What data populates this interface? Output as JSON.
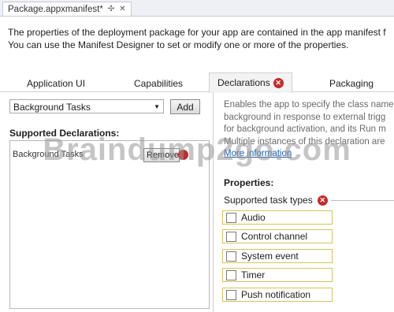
{
  "document_tab": {
    "title": "Package.appxmanifest*",
    "pin_icon": "pin-icon",
    "close_icon": "close-icon"
  },
  "description": {
    "line1": "The properties of the deployment package for your app are contained in the app manifest file.",
    "line2": "You can use the Manifest Designer to set or modify one or more of the properties."
  },
  "tabs": [
    {
      "label": "Application UI"
    },
    {
      "label": "Capabilities"
    },
    {
      "label": "Declarations",
      "error": true
    },
    {
      "label": "Packaging"
    }
  ],
  "declarations": {
    "selected": "Background Tasks",
    "add_label": "Add",
    "supported_label": "Supported Declarations:",
    "list_item": "Background Tasks",
    "remove_label": "Remove"
  },
  "right": {
    "desc_lines": [
      "Enables the app to specify the class name",
      "background in response to external trigg",
      "for background activation, and its Run m",
      "Multiple instances of this declaration are",
      "More information"
    ],
    "properties_label": "Properties:",
    "supported_task_types": "Supported task types",
    "tasks": [
      "Audio",
      "Control channel",
      "System event",
      "Timer",
      "Push notification"
    ]
  },
  "watermark": "Braindump2go.com",
  "colors": {
    "error": "#c42b2b",
    "task_border": "#d7c35a"
  }
}
